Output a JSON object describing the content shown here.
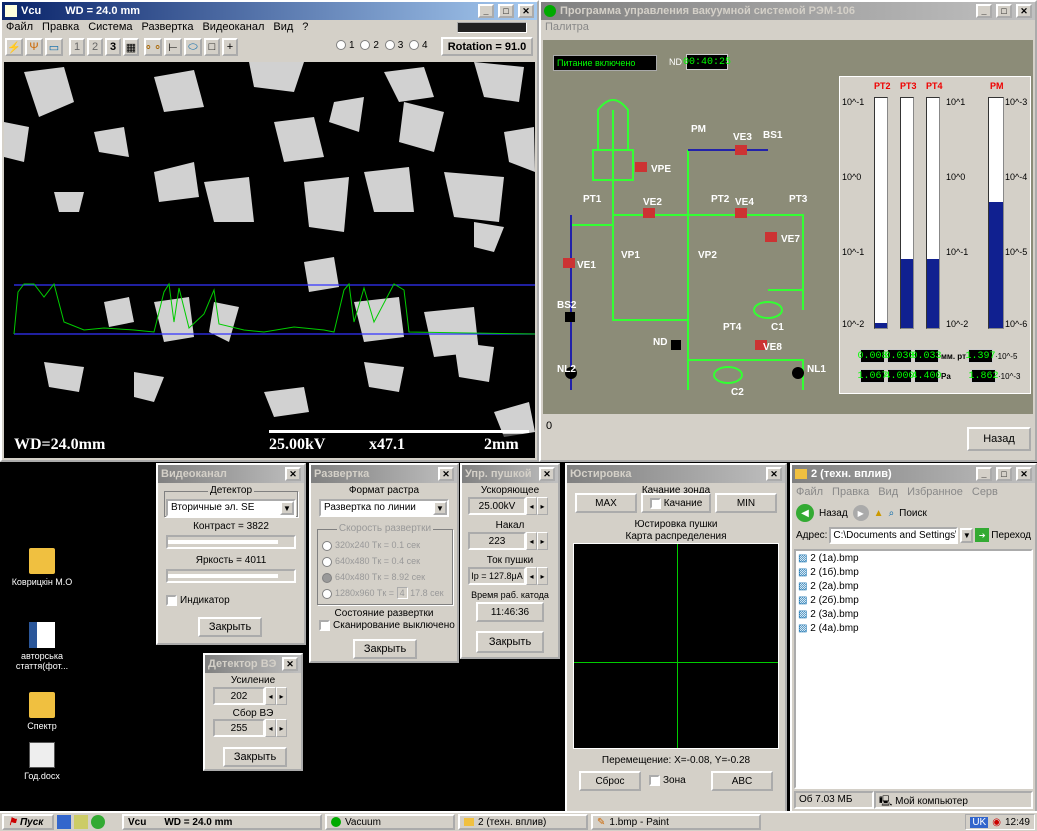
{
  "sem": {
    "title": "Vcu",
    "title_wd": "WD = 24.0 mm",
    "menu": [
      "Файл",
      "Правка",
      "Система",
      "Развертка",
      "Видеоканал",
      "Вид",
      "?"
    ],
    "tool_nums": [
      "1",
      "2",
      "3"
    ],
    "radios": [
      "1",
      "2",
      "3",
      "4"
    ],
    "rotation": "Rotation = 91.0",
    "overlay_wd": "WD=24.0mm",
    "overlay_kv": "25.00kV",
    "overlay_mag": "x47.1",
    "overlay_scale": "2mm"
  },
  "vac": {
    "title": "Программа управления вакуумной системой РЭМ-106",
    "menu": "Палитра",
    "power": "Питание включено",
    "nd_label": "ND",
    "nd_time": "00:40:25",
    "status_line": "0",
    "back_label": "Назад",
    "labels": {
      "pm": "PM",
      "bs1": "BS1",
      "vpe": "VPE",
      "ve3": "VE3",
      "pt1": "PT1",
      "pt2": "PT2",
      "pt3": "PT3",
      "ve2": "VE2",
      "ve4": "VE4",
      "ve7": "VE7",
      "ve1": "VE1",
      "vp1": "VP1",
      "vp2": "VP2",
      "bs2": "BS2",
      "c1": "C1",
      "pt4": "PT4",
      "nd": "ND",
      "ve8": "VE8",
      "c2": "C2",
      "nl1": "NL1",
      "nl2": "NL2"
    },
    "gauge_heads": [
      "PT2",
      "PT3",
      "PT4",
      "PM"
    ],
    "scale_left": [
      "10^-1",
      "10^0",
      "10^-1",
      "10^-2"
    ],
    "scale_mid": [
      "10^1",
      "10^0",
      "10^-1",
      "10^-2"
    ],
    "scale_right": [
      "10^-3",
      "10^-4",
      "10^-5",
      "10^-6"
    ],
    "row1": [
      "0.008",
      "0.030",
      "0.033"
    ],
    "row1_unit": "мм. рт",
    "row1_pm": "1.397",
    "row1_exp": "·10^-5",
    "row2": [
      "1.067",
      "4.000",
      "4.400"
    ],
    "row2_unit": "Pa",
    "row2_pm": "1.862",
    "row2_exp": "·10^-3",
    "bar_levels": [
      0.02,
      0.3,
      0.3,
      0.55
    ]
  },
  "video": {
    "title": "Видеоканал",
    "detector_cap": "Детектор",
    "detector_val": "Вторичные эл. SE",
    "contrast": "Контраст = 3822",
    "brightness": "Яркость = 4011",
    "indicator": "Индикатор",
    "close": "Закрыть"
  },
  "scan": {
    "title": "Развертка",
    "format_cap": "Формат растра",
    "format_val": "Развертка по линии",
    "speed_cap": "Скорость развертки",
    "speeds": [
      "320x240 Tк = 0.1 сек",
      "640x480 Tк = 0.4 сек",
      "640x480 Tк = 8.92 сек",
      "1280x960 Tк ="
    ],
    "speed_extra_num": "4",
    "speed_extra": "17.8 сек",
    "state_cap": "Состояние развертки",
    "state_val": "Сканирование выключено",
    "close": "Закрыть"
  },
  "gun": {
    "title": "Упр. пушкой",
    "accel_cap": "Ускоряющее",
    "accel_val": "25.00kV",
    "heat_cap": "Накал",
    "heat_val": "223",
    "current_cap": "Ток пушки",
    "current_val": "Ip = 127.8μA",
    "time_cap": "Время раб. катода",
    "time_val": "11:46:36",
    "close": "Закрыть"
  },
  "bse": {
    "title": "Детектор ВЭ",
    "gain_cap": "Усиление",
    "gain_val": "202",
    "col_cap": "Сбор ВЭ",
    "col_val": "255",
    "close": "Закрыть"
  },
  "align": {
    "title": "Юстировка",
    "swing_cap": "Качание зонда",
    "max": "MAX",
    "swing": "Качание",
    "min": "MIN",
    "gun_cap": "Юстировка пушки",
    "map_cap": "Карта распределения",
    "move": "Перемещение: X=-0.08, Y=-0.28",
    "reset": "Сброс",
    "zone": "Зона",
    "abc": "ABC"
  },
  "exp": {
    "title": "2 (техн. вплив)",
    "menu": [
      "Файл",
      "Правка",
      "Вид",
      "Избранное",
      "Серв"
    ],
    "back": "Назад",
    "search": "Поиск",
    "addr_label": "Адрес:",
    "addr": "C:\\Documents and Settings\\",
    "go": "Переход",
    "files": [
      "2 (1а).bmp",
      "2 (1б).bmp",
      "2 (2а).bmp",
      "2 (2б).bmp",
      "2 (3а).bmp",
      "2 (4а).bmp"
    ],
    "status_size": "Об 7.03 МБ",
    "status_loc": "Мой компьютер"
  },
  "desk": [
    {
      "label": "Коврицкін М.О"
    },
    {
      "label": "авторська стаття(фот..."
    },
    {
      "label": "Спектр"
    },
    {
      "label": "Год.docx"
    }
  ],
  "task": {
    "start": "Пуск",
    "items": [
      "Vcu",
      "WD = 24.0 mm",
      "Vacuum",
      "2 (техн. вплив)",
      "1.bmp - Paint"
    ],
    "lang": "UK",
    "clock": "12:49"
  }
}
